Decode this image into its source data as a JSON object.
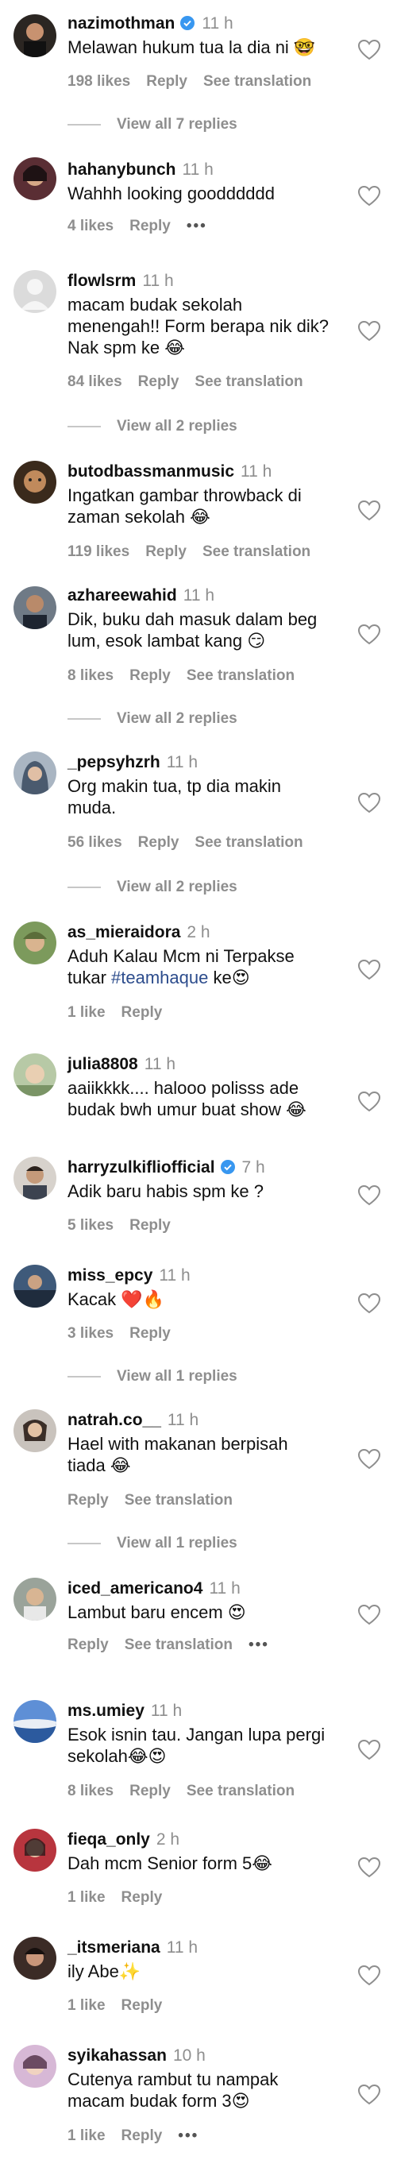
{
  "ui": {
    "likes_suffix": "likes",
    "reply": "Reply",
    "see_translation": "See translation",
    "more": "•••"
  },
  "comments": [
    {
      "username": "nazimothman",
      "verified": true,
      "time": "11 h",
      "text": "Melawan hukum tua la dia ni 🤓",
      "likes": "198 likes",
      "show_translation": true,
      "replies": "View all 7 replies"
    },
    {
      "username": "hahanybunch",
      "verified": false,
      "time": "11 h",
      "text": "Wahhh looking goodddddd",
      "likes": "4 likes",
      "show_translation": false,
      "show_more": true
    },
    {
      "username": "flowlsrm",
      "verified": false,
      "time": "11 h",
      "text": "macam budak sekolah\nmenengah!! Form berapa nik dik?\nNak spm ke 😂",
      "likes": "84 likes",
      "show_translation": true,
      "replies": "View all 2 replies"
    },
    {
      "username": "butodbassmanmusic",
      "verified": false,
      "time": "11 h",
      "text": "Ingatkan gambar throwback di\nzaman sekolah 😂",
      "likes": "119 likes",
      "show_translation": true
    },
    {
      "username": "azhareewahid",
      "verified": false,
      "time": "11 h",
      "text": "Dik, buku dah masuk dalam beg\nlum, esok lambat kang 😏",
      "likes": "8 likes",
      "show_translation": true,
      "replies": "View all 2 replies"
    },
    {
      "username": "_pepsyhzrh",
      "verified": false,
      "time": "11 h",
      "text": "Org makin tua, tp dia makin\nmuda.",
      "likes": "56 likes",
      "show_translation": true,
      "replies": "View all 2 replies"
    },
    {
      "username": "as_mieraidora",
      "verified": false,
      "time": "2 h",
      "text_before": "Aduh Kalau Mcm ni Terpakse\ntukar ",
      "hashtag": "#teamhaque",
      "text_after": " ke😍",
      "likes": "1 like",
      "show_translation": false
    },
    {
      "username": "julia8808",
      "verified": false,
      "time": "11 h",
      "text": "aaiikkkk.... halooo polisss ade\nbudak bwh umur buat show 😂",
      "likes": "",
      "show_translation": false
    },
    {
      "username": "harryzulkifliofficial",
      "verified": true,
      "time": "7 h",
      "text": "Adik baru habis spm ke ?",
      "likes": "5 likes",
      "show_translation": false
    },
    {
      "username": "miss_epcy",
      "verified": false,
      "time": "11 h",
      "text": "Kacak ❤️🔥",
      "likes": "3 likes",
      "show_translation": false,
      "replies": "View all 1 replies"
    },
    {
      "username": "natrah.co__",
      "verified": false,
      "time": "11 h",
      "text": "Hael with makanan berpisah\ntiada 😂",
      "likes": "",
      "show_translation": true,
      "replies": "View all 1 replies"
    },
    {
      "username": "iced_americano4",
      "verified": false,
      "time": "11 h",
      "text": "Lambut baru encem 😍",
      "likes": "",
      "show_translation": true,
      "show_more": true
    },
    {
      "username": "ms.umiey",
      "verified": false,
      "time": "11 h",
      "text": "Esok isnin tau. Jangan lupa pergi\nsekolah😂😍",
      "likes": "8 likes",
      "show_translation": true
    },
    {
      "username": "fieqa_only",
      "verified": false,
      "time": "2 h",
      "text": "Dah mcm Senior form 5😂",
      "likes": "1 like",
      "show_translation": false
    },
    {
      "username": "_itsmeriana",
      "verified": false,
      "time": "11 h",
      "text": "ily Abe✨",
      "likes": "1 like",
      "show_translation": false
    },
    {
      "username": "syikahassan",
      "verified": false,
      "time": "10 h",
      "text": "Cutenya rambut tu nampak\nmacam budak form 3😍",
      "likes": "1 like",
      "show_translation": false,
      "show_more": true
    }
  ],
  "colors": {
    "text": "#111111",
    "secondary": "#8e8e8e",
    "verified": "#3897f0",
    "hashtag": "#2c4c8c",
    "divider": "#c7c7c7"
  },
  "icons": {
    "like": "heart-outline-icon",
    "verified": "verified-badge-icon",
    "more": "more-dots-icon"
  }
}
